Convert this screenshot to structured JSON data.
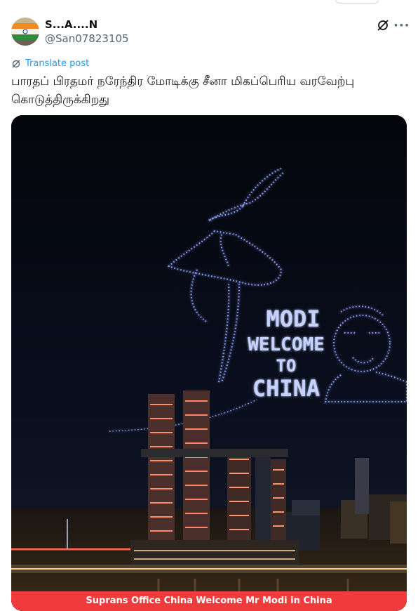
{
  "author": {
    "name": "S...A....N",
    "handle": "@San07823105"
  },
  "translate_label": "Translate post",
  "post_text": "பாரதப் பிரதமர் நரேந்திர மோடிக்கு சீனா மிகப்பெரிய வரவேற்பு கொடுத்திருக்கிறது",
  "media": {
    "drone_text": [
      "MODI",
      "WELCOME",
      "TO",
      "CHINA"
    ],
    "caption": "Suprans Office China Welcome Mr Modi in China"
  },
  "colors": {
    "link": "#1d9bf0",
    "secondary_text": "#536471",
    "drone_glow": "#7f9bff",
    "caption_bg": "#ef3b3b"
  },
  "icons": [
    "grok-icon",
    "more-icon",
    "translate-icon"
  ]
}
